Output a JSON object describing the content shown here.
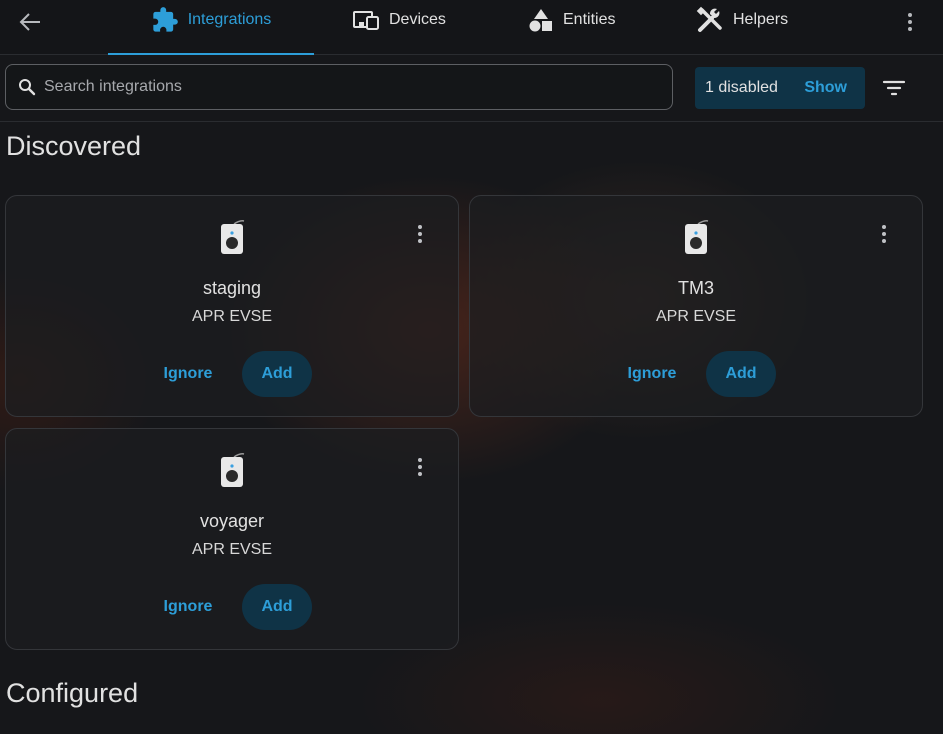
{
  "header": {
    "tabs": [
      {
        "label": "Integrations",
        "icon": "puzzle-icon",
        "active": true
      },
      {
        "label": "Devices",
        "icon": "devices-icon",
        "active": false
      },
      {
        "label": "Entities",
        "icon": "shapes-icon",
        "active": false
      },
      {
        "label": "Helpers",
        "icon": "tools-icon",
        "active": false
      }
    ]
  },
  "search": {
    "placeholder": "Search integrations",
    "value": ""
  },
  "filters": {
    "disabled_label": "1 disabled",
    "show_label": "Show"
  },
  "sections": {
    "discovered": "Discovered",
    "configured": "Configured"
  },
  "discovered": [
    {
      "name": "staging",
      "type": "APR EVSE",
      "ignore_label": "Ignore",
      "add_label": "Add"
    },
    {
      "name": "TM3",
      "type": "APR EVSE",
      "ignore_label": "Ignore",
      "add_label": "Add"
    },
    {
      "name": "voyager",
      "type": "APR EVSE",
      "ignore_label": "Ignore",
      "add_label": "Add"
    }
  ],
  "colors": {
    "accent": "#2d9ed8",
    "chip_bg": "#0f3346",
    "background": "#16171a"
  }
}
